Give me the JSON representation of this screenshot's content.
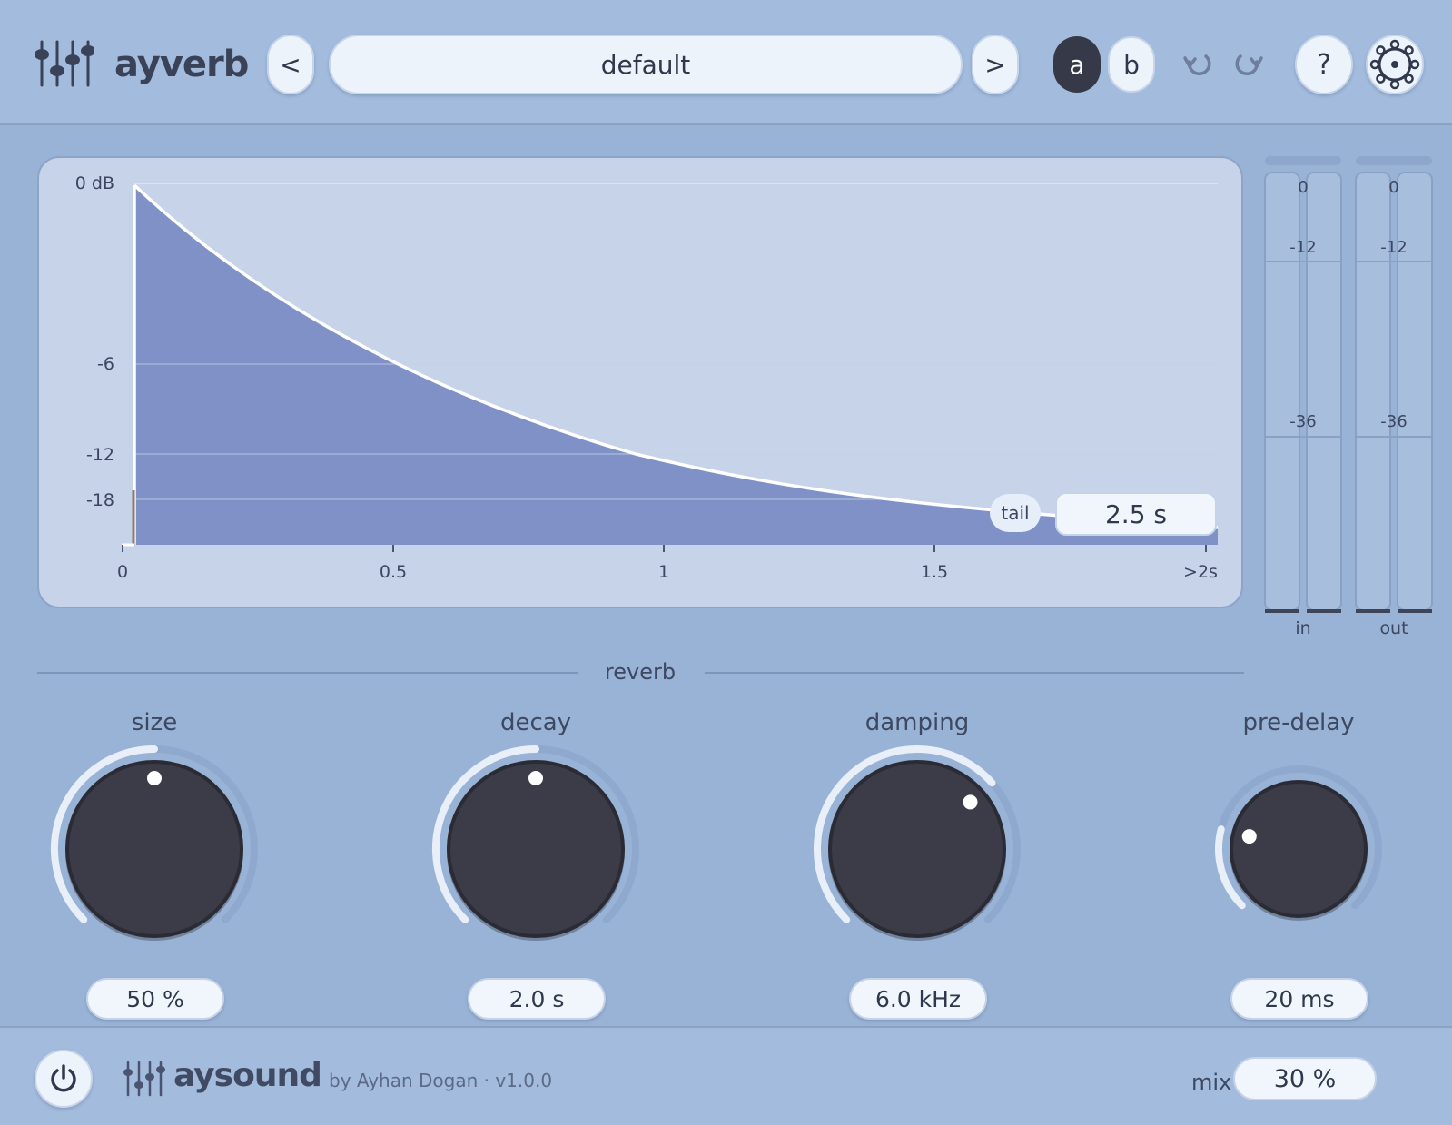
{
  "header": {
    "title": "ayverb",
    "prev_label": "<",
    "next_label": ">",
    "preset": "default",
    "a_label": "a",
    "b_label": "b",
    "active_slot": "a",
    "help_label": "?",
    "icons": [
      "logo-sliders-icon",
      "undo-icon",
      "redo-icon",
      "settings-icon"
    ]
  },
  "graph": {
    "y_labels": [
      "0 dB",
      "-6",
      "-12",
      "-18"
    ],
    "x_labels": [
      "0",
      "0.5",
      "1",
      "1.5",
      ">2s"
    ],
    "tail_label": "tail",
    "tail_value": "2.5 s"
  },
  "meters": {
    "in": {
      "label": "in",
      "scale": [
        "0",
        "-12",
        "-36"
      ]
    },
    "out": {
      "label": "out",
      "scale": [
        "0",
        "-12",
        "-36"
      ]
    }
  },
  "section": {
    "title": "reverb"
  },
  "knobs": [
    {
      "name": "size",
      "value": "50 %",
      "level": 0.5
    },
    {
      "name": "decay",
      "value": "2.0 s",
      "level": 0.5
    },
    {
      "name": "damping",
      "value": "6.0 kHz",
      "level": 0.68
    },
    {
      "name": "pre-delay",
      "value": "20 ms",
      "level": 0.22
    }
  ],
  "footer": {
    "brand": "aysound",
    "credits": "by Ayhan Dogan · v1.0.0",
    "mix_label": "mix",
    "mix_value": "30 %"
  },
  "colors": {
    "background": "#99b3d6",
    "header": "#a3bbdc",
    "graph_bg": "#c6d3e8",
    "graph_fill": "#7f91c6",
    "knob": "#3b3c48",
    "active_button": "#363a48"
  }
}
